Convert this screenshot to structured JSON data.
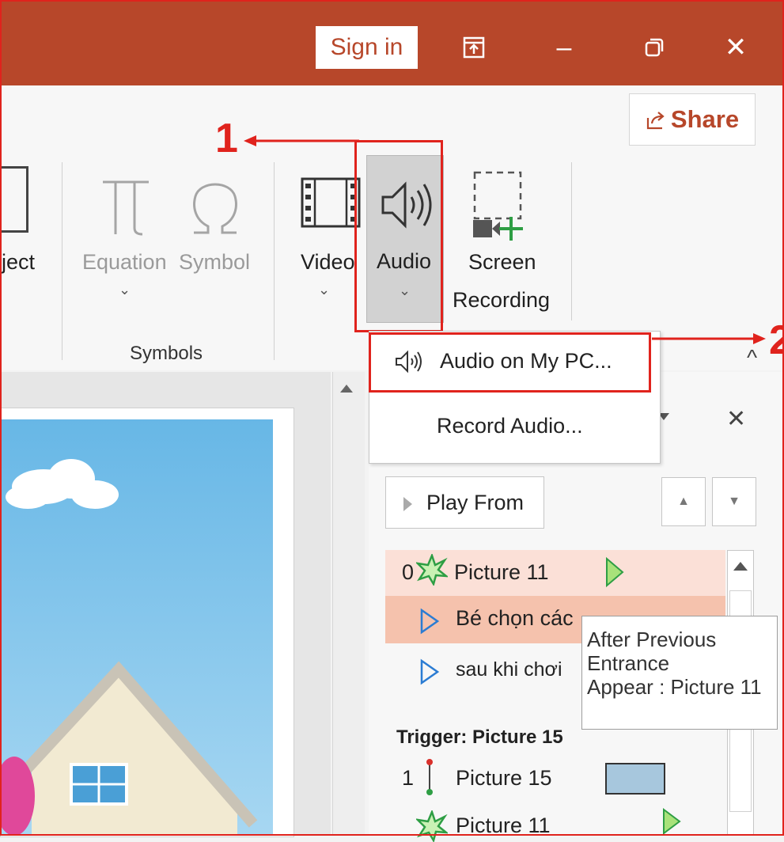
{
  "titlebar": {
    "sign_in_label": "Sign in",
    "ribbon_display_icon": "ribbon-display-icon",
    "minimize_glyph": "–",
    "restore_glyph": "▢",
    "close_glyph": "✕"
  },
  "share": {
    "label": "Share",
    "icon": "share-icon"
  },
  "ribbon": {
    "object_label": "ject",
    "equation_label": "Equation",
    "symbol_label": "Symbol",
    "symbols_group_label": "Symbols",
    "video_label": "Video",
    "audio_label": "Audio",
    "screen_recording_line1": "Screen",
    "screen_recording_line2": "Recording",
    "chevron": "⌄",
    "collapse_glyph": "^"
  },
  "audio_menu": {
    "items": [
      {
        "label": "Audio on My PC...",
        "icon": "speaker-icon"
      },
      {
        "label": "Record Audio..."
      }
    ]
  },
  "annotations": {
    "step1": "1",
    "step2": "2"
  },
  "animation_pane": {
    "close_glyph": "✕",
    "play_from_label": "Play From",
    "rows": [
      {
        "index": "0",
        "label": "Picture 11"
      },
      {
        "label": "Bé chọn các"
      },
      {
        "label": "sau khi chơi"
      }
    ],
    "trigger_label": "Trigger: Picture 15",
    "trigger_rows": [
      {
        "index": "1",
        "label": "Picture 15"
      },
      {
        "label": "Picture 11"
      }
    ]
  },
  "tooltip": {
    "line1": "After Previous",
    "line2": "Entrance",
    "line3": "Appear : Picture 11"
  },
  "colors": {
    "accent": "#b7472a",
    "callout_red": "#e0231d",
    "row_highlight": "#fbe0d7",
    "row_selected": "#f5c2ad"
  }
}
